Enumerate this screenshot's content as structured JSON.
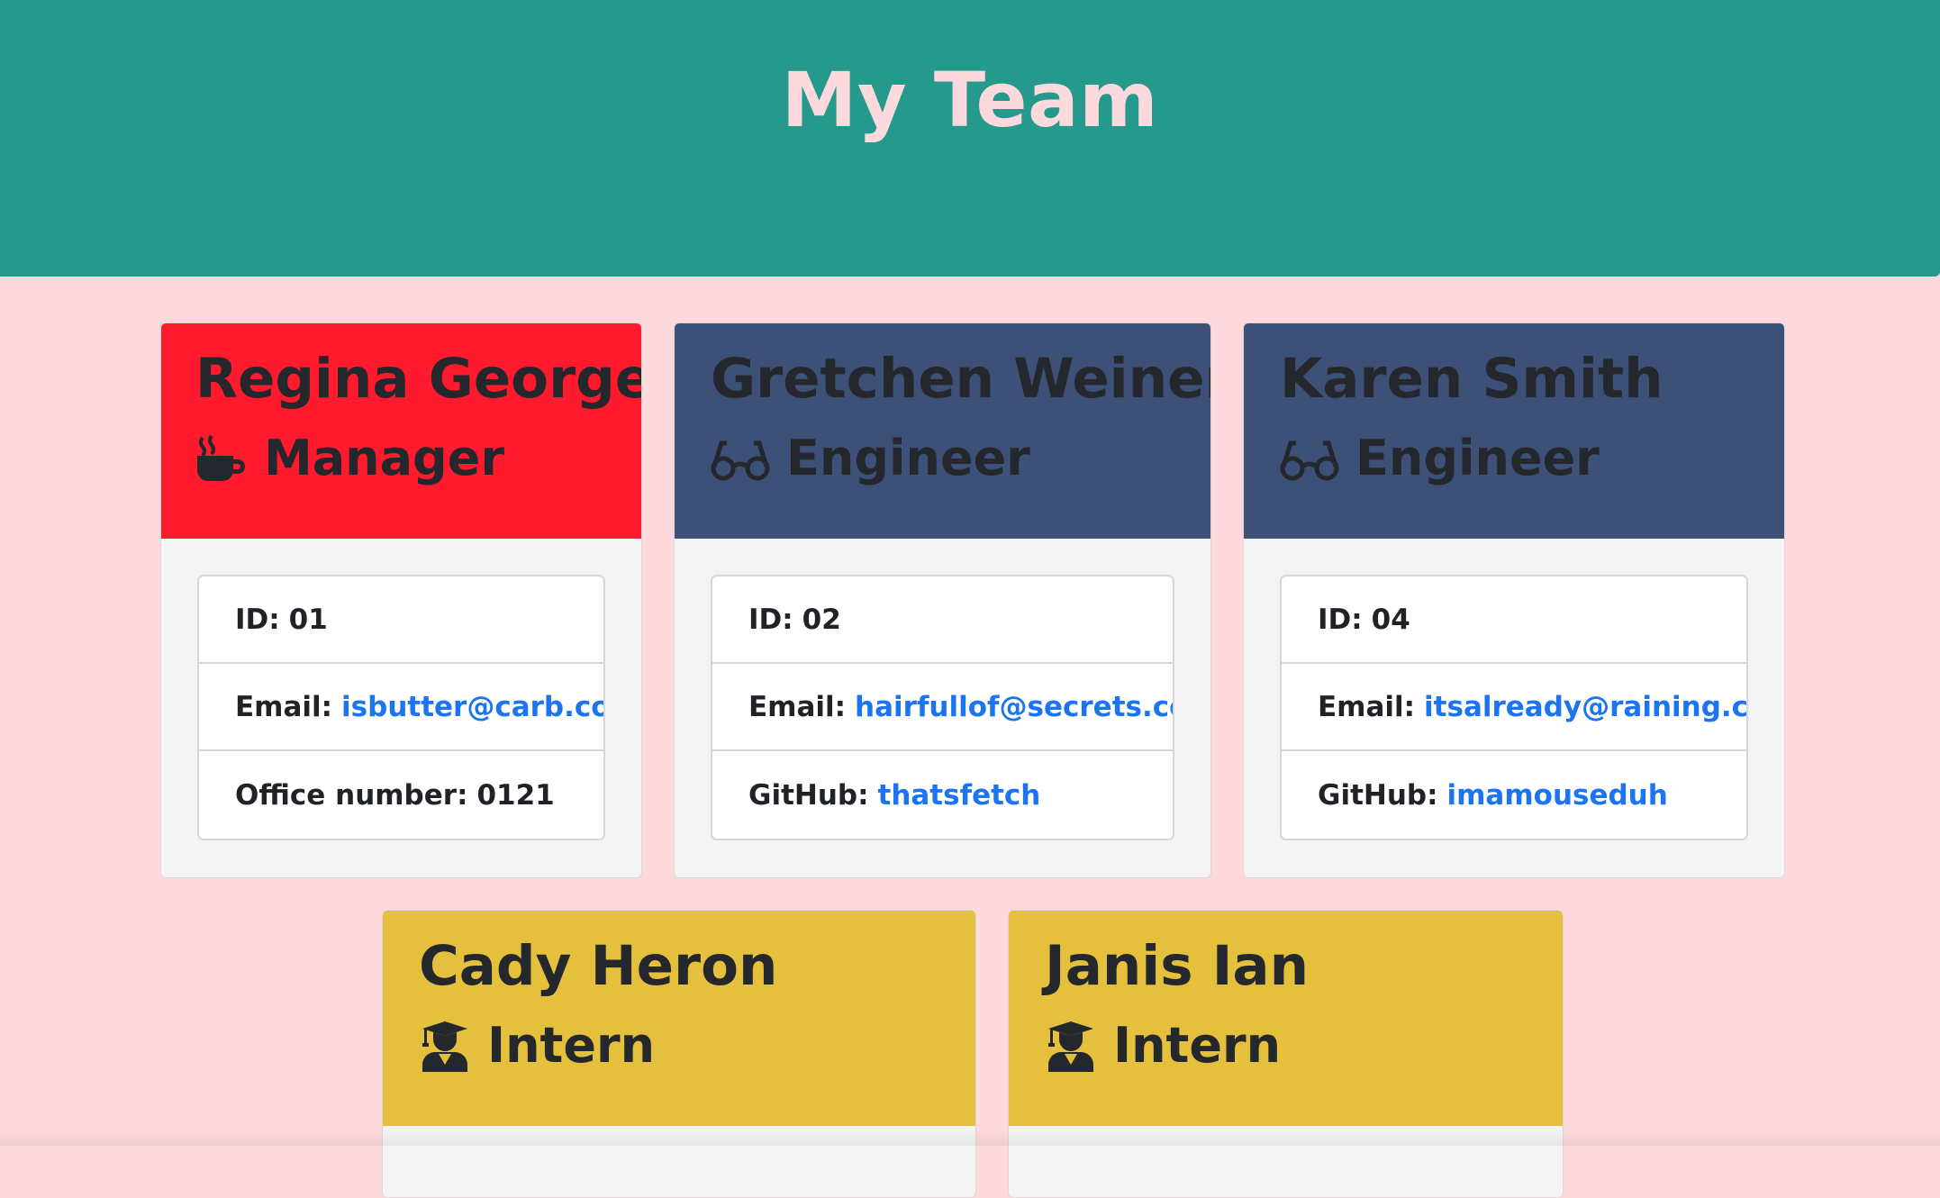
{
  "header": {
    "title": "My Team"
  },
  "members": [
    {
      "name": "Regina George",
      "role": "Manager",
      "icon": "coffee-icon",
      "id_label": "ID:",
      "id_value": "01",
      "email_label": "Email:",
      "email": "isbutter@carb.com",
      "extra_label": "Office number:",
      "extra_value": "0121"
    },
    {
      "name": "Gretchen Weiners",
      "role": "Engineer",
      "icon": "glasses-icon",
      "id_label": "ID:",
      "id_value": "02",
      "email_label": "Email:",
      "email": "hairfullof@secrets.com",
      "extra_label": "GitHub:",
      "extra_value": "thatsfetch"
    },
    {
      "name": "Karen Smith",
      "role": "Engineer",
      "icon": "glasses-icon",
      "id_label": "ID:",
      "id_value": "04",
      "email_label": "Email:",
      "email": "itsalready@raining.com",
      "extra_label": "GitHub:",
      "extra_value": "imamouseduh"
    },
    {
      "name": "Cady Heron",
      "role": "Intern",
      "icon": "graduate-icon"
    },
    {
      "name": "Janis Ian",
      "role": "Intern",
      "icon": "graduate-icon"
    }
  ],
  "colors": {
    "header_bg": "#259a8c",
    "header_text": "#fcd9dc",
    "page_bg": "#fdd9dd",
    "manager": "#ff1a2e",
    "engineer": "#3c5078",
    "intern": "#e5c03c",
    "link": "#1b74f2"
  }
}
